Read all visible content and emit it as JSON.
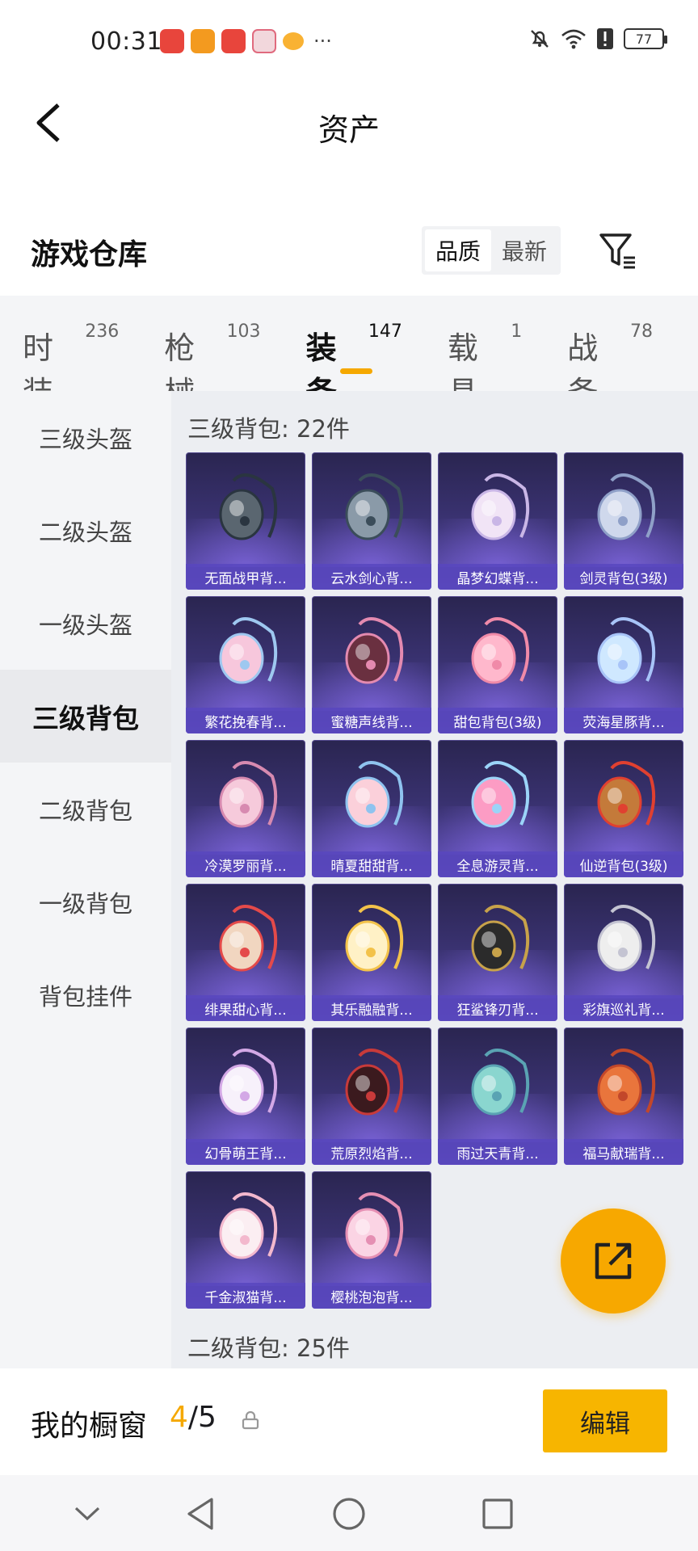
{
  "status_bar": {
    "time": "00:31",
    "more": "···",
    "battery": "77"
  },
  "header": {
    "title": "资产"
  },
  "section": {
    "title": "游戏仓库",
    "sort_options": [
      "品质",
      "最新"
    ]
  },
  "category_tabs": [
    {
      "label": "时装",
      "count": "236"
    },
    {
      "label": "枪械",
      "count": "103"
    },
    {
      "label": "装备",
      "count": "147"
    },
    {
      "label": "载具",
      "count": "1"
    },
    {
      "label": "战备",
      "count": "78"
    }
  ],
  "sidebar": {
    "items": [
      "三级头盔",
      "二级头盔",
      "一级头盔",
      "三级背包",
      "二级背包",
      "一级背包",
      "背包挂件"
    ],
    "active": "三级背包"
  },
  "groups": [
    {
      "title": "三级背包: 22件",
      "items": [
        {
          "name": "无面战甲背...",
          "icon": "armor-backpack-icon"
        },
        {
          "name": "云水剑心背...",
          "icon": "sword-backpack-icon"
        },
        {
          "name": "晶梦幻蝶背...",
          "icon": "butterfly-backpack-icon"
        },
        {
          "name": "剑灵背包(3级)",
          "icon": "spirit-backpack-icon"
        },
        {
          "name": "繁花挽春背...",
          "icon": "flower-backpack-icon"
        },
        {
          "name": "蜜糖声线背...",
          "icon": "guitar-backpack-icon"
        },
        {
          "name": "甜包背包(3级)",
          "icon": "doll-backpack-icon"
        },
        {
          "name": "荧海星豚背...",
          "icon": "dolphin-backpack-icon"
        },
        {
          "name": "冷漠罗丽背...",
          "icon": "heart-backpack-icon"
        },
        {
          "name": "晴夏甜甜背...",
          "icon": "shell-backpack-icon"
        },
        {
          "name": "全息游灵背...",
          "icon": "apple-backpack-icon"
        },
        {
          "name": "仙逆背包(3级)",
          "icon": "ornament-backpack-icon"
        },
        {
          "name": "绯果甜心背...",
          "icon": "clown-backpack-icon"
        },
        {
          "name": "其乐融融背...",
          "icon": "cupcake-backpack-icon"
        },
        {
          "name": "狂鲨锋刃背...",
          "icon": "shark-backpack-icon"
        },
        {
          "name": "彩旗巡礼背...",
          "icon": "drum-backpack-icon"
        },
        {
          "name": "幻骨萌王背...",
          "icon": "ghost-backpack-icon"
        },
        {
          "name": "荒原烈焰背...",
          "icon": "flame-backpack-icon"
        },
        {
          "name": "雨过天青背...",
          "icon": "vase-backpack-icon"
        },
        {
          "name": "福马献瑞背...",
          "icon": "horse-backpack-icon"
        },
        {
          "name": "千金淑猫背...",
          "icon": "cat-backpack-icon"
        },
        {
          "name": "樱桃泡泡背...",
          "icon": "bow-backpack-icon"
        }
      ]
    },
    {
      "title": "二级背包: 25件"
    }
  ],
  "showcase": {
    "title": "我的橱窗",
    "current": "4",
    "total": "/5",
    "edit_label": "编辑"
  },
  "colors": {
    "accent": "#f5a800",
    "card_bg": "#3c3476",
    "caption_bg": "#5846be"
  }
}
